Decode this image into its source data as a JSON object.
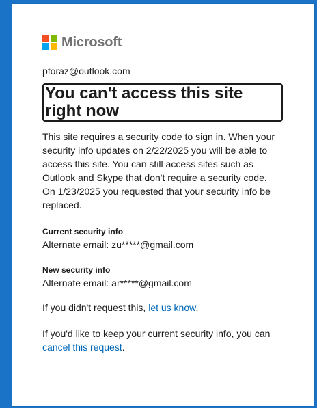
{
  "brand": {
    "name": "Microsoft",
    "logo_colors": [
      "#f25022",
      "#7fba00",
      "#00a4ef",
      "#ffb900"
    ]
  },
  "account": {
    "email": "pforaz@outlook.com"
  },
  "page": {
    "title": "You can't access this site right now",
    "description": "This site requires a security code to sign in. When your security info updates on 2/22/2025 you will be able to access this site. You can still access sites such as Outlook and Skype that don't require a security code.",
    "request_note": "On 1/23/2025 you requested that your security info be replaced."
  },
  "current_info": {
    "label": "Current security info",
    "value": "Alternate email: zu*****@gmail.com"
  },
  "new_info": {
    "label": "New security info",
    "value": "Alternate email: ar*****@gmail.com"
  },
  "didnt_request": {
    "prefix": "If you didn't request this, ",
    "link": "let us know",
    "suffix": "."
  },
  "keep_current": {
    "prefix": "If you'd like to keep your current security info, you can ",
    "link": "cancel this request",
    "suffix": "."
  },
  "colors": {
    "background": "#1a73c7",
    "link": "#0067b8",
    "text": "#1b1b1b"
  }
}
